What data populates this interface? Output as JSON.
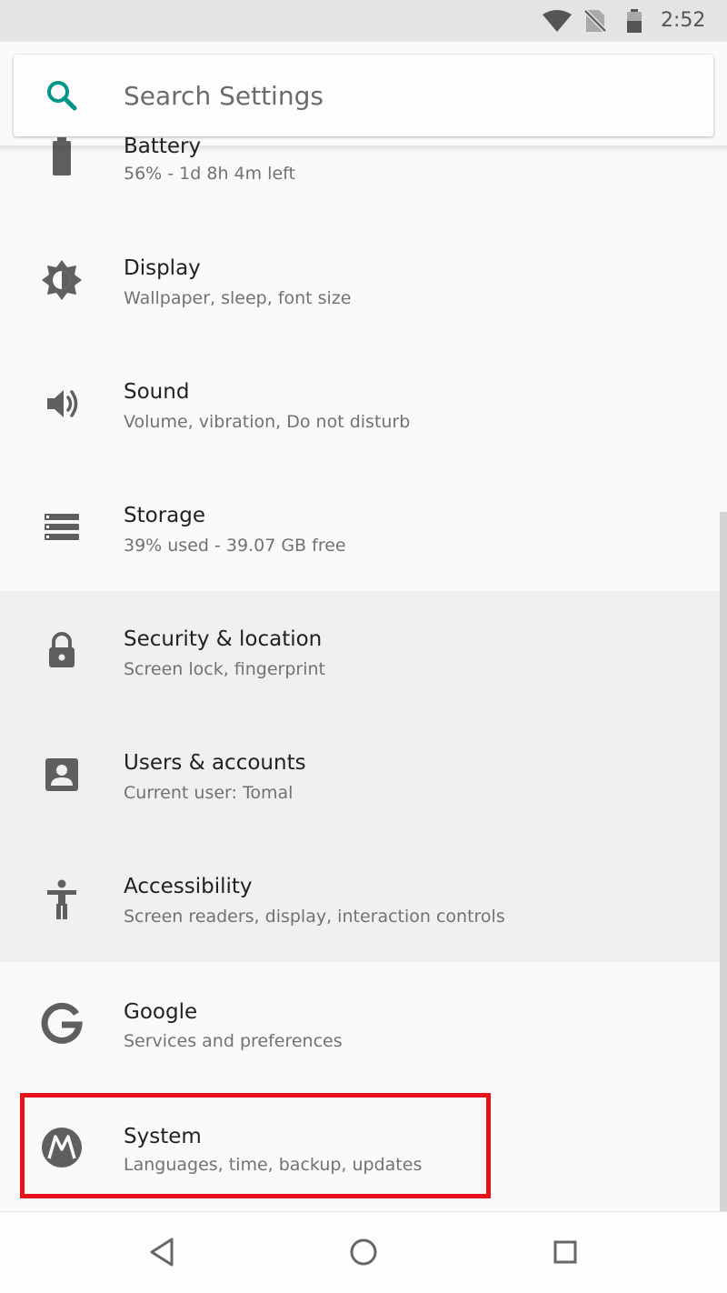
{
  "status_bar": {
    "time": "2:52",
    "icons": [
      "wifi-icon",
      "no-sim-icon",
      "battery-icon"
    ]
  },
  "search": {
    "placeholder": "Search Settings",
    "icon": "search-icon",
    "accent_color": "#009688"
  },
  "settings": {
    "items": [
      {
        "title": "Battery",
        "summary": "56% - 1d 8h 4m left",
        "icon": "battery-icon"
      },
      {
        "title": "Display",
        "summary": "Wallpaper, sleep, font size",
        "icon": "brightness-icon"
      },
      {
        "title": "Sound",
        "summary": "Volume, vibration, Do not disturb",
        "icon": "volume-icon"
      },
      {
        "title": "Storage",
        "summary": "39% used - 39.07 GB free",
        "icon": "storage-icon"
      },
      {
        "title": "Security & location",
        "summary": "Screen lock, fingerprint",
        "icon": "lock-icon"
      },
      {
        "title": "Users & accounts",
        "summary": "Current user: Tomal",
        "icon": "account-box-icon"
      },
      {
        "title": "Accessibility",
        "summary": "Screen readers, display, interaction controls",
        "icon": "accessibility-icon"
      },
      {
        "title": "Google",
        "summary": "Services and preferences",
        "icon": "google-icon"
      },
      {
        "title": "System",
        "summary": "Languages, time, backup, updates",
        "icon": "motorola-icon"
      }
    ],
    "highlight_color": "#e8121c",
    "icon_color": "#5f5f5f"
  },
  "nav_bar": {
    "icons": [
      "back-icon",
      "home-icon",
      "recents-icon"
    ]
  }
}
